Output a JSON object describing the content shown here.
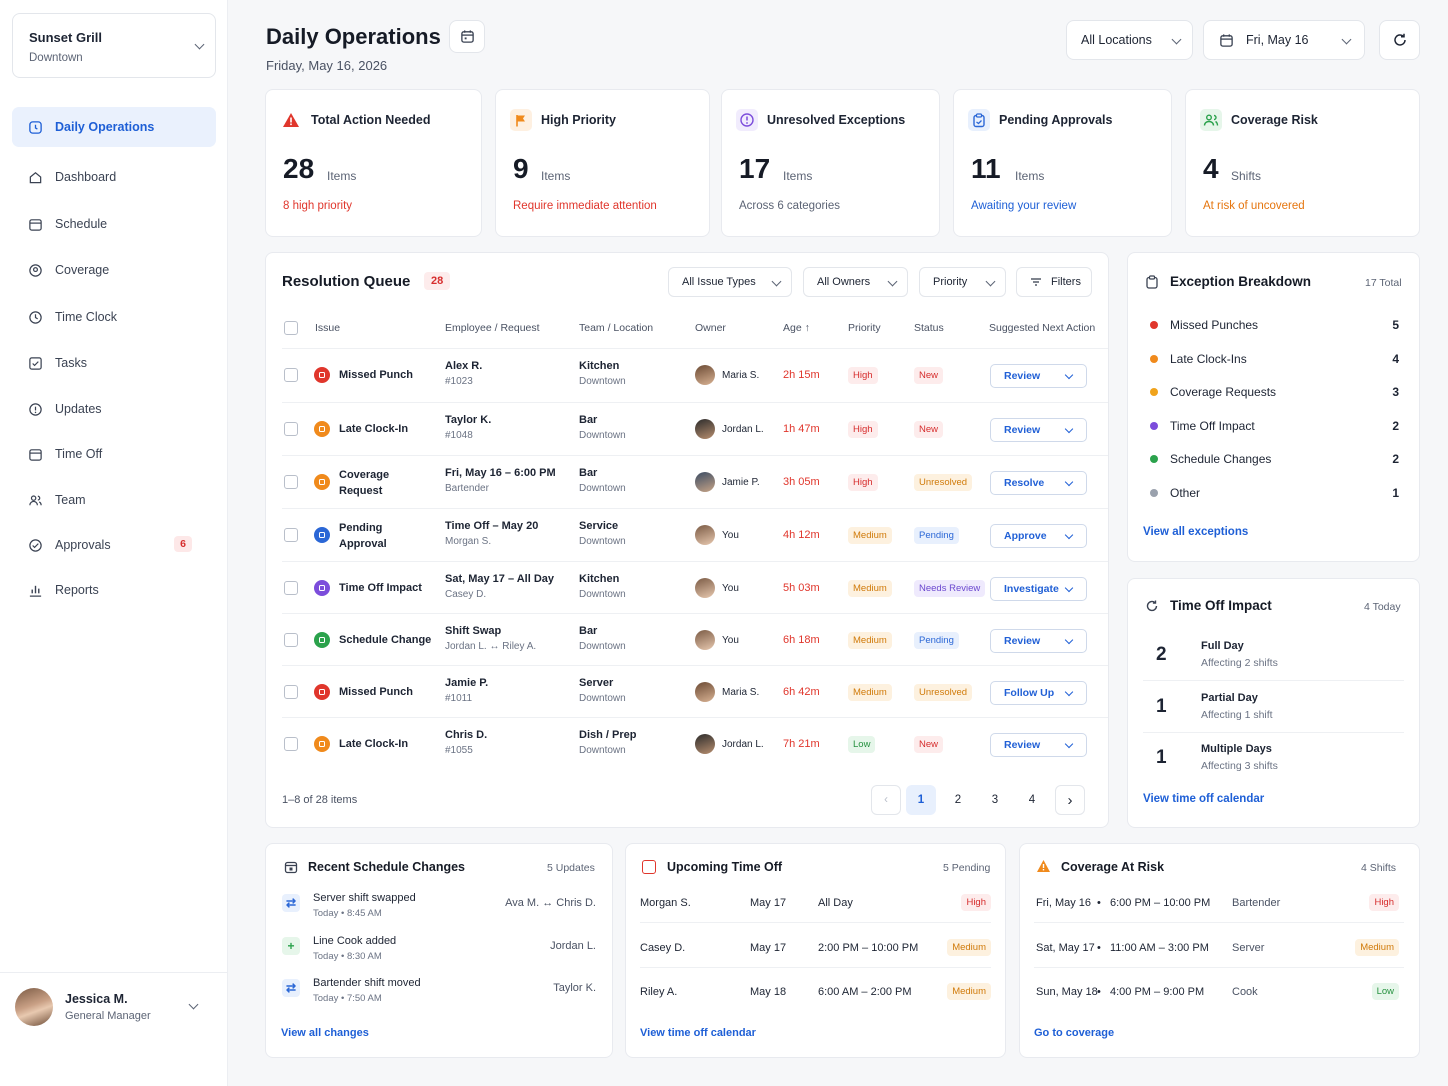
{
  "location": {
    "name": "Sunset Grill",
    "sub": "Downtown"
  },
  "nav": [
    {
      "label": "Daily Operations",
      "icon": "daily-ops-icon"
    },
    {
      "label": "Dashboard",
      "icon": "home-icon"
    },
    {
      "label": "Schedule",
      "icon": "calendar-icon"
    },
    {
      "label": "Coverage",
      "icon": "coverage-icon"
    },
    {
      "label": "Time Clock",
      "icon": "clock-icon"
    },
    {
      "label": "Tasks",
      "icon": "checkbox-icon"
    },
    {
      "label": "Updates",
      "icon": "info-icon"
    },
    {
      "label": "Time Off",
      "icon": "calendar-icon"
    },
    {
      "label": "Team",
      "icon": "team-icon"
    },
    {
      "label": "Approvals",
      "icon": "approvals-icon",
      "badge": "6"
    },
    {
      "label": "Reports",
      "icon": "chart-icon"
    }
  ],
  "user": {
    "name": "Jessica M.",
    "role": "General Manager"
  },
  "header": {
    "title": "Daily Operations",
    "date": "Friday, May 16, 2026",
    "location_filter": "All Locations",
    "date_filter": "Fri, May 16"
  },
  "stats": [
    {
      "label": "Total Action Needed",
      "value": "28",
      "unit": "Items",
      "sub": "8 high priority",
      "color": "#e0362c"
    },
    {
      "label": "High Priority",
      "value": "9",
      "unit": "Items",
      "sub": "Require immediate attention",
      "color": "#e0362c"
    },
    {
      "label": "Unresolved Exceptions",
      "value": "17",
      "unit": "Items",
      "sub": "Across 6 categories",
      "color": "#5c6475"
    },
    {
      "label": "Pending Approvals",
      "value": "11",
      "unit": "Items",
      "sub": "Awaiting your review",
      "color": "#1e5fd6"
    },
    {
      "label": "Coverage Risk",
      "value": "4",
      "unit": "Shifts",
      "sub": "At risk of uncovered",
      "color": "#e5750e"
    }
  ],
  "queue": {
    "title": "Resolution Queue",
    "count": "28",
    "filters": [
      "All Issue Types",
      "All Owners",
      "Priority",
      "Filters"
    ],
    "columns": [
      "Issue",
      "Employee / Request",
      "Team / Location",
      "Owner",
      "Age",
      "Priority",
      "Status",
      "Suggested Next Action"
    ],
    "rows": [
      {
        "issue": "Missed Punch",
        "issue_color": "#e0362c",
        "emp": "Alex R.",
        "emp_sub": "#1023",
        "team": "Kitchen",
        "loc": "Downtown",
        "owner": "Maria S.",
        "age": "2h 15m",
        "priority": "High",
        "status": "New",
        "action": "Review"
      },
      {
        "issue": "Late Clock-In",
        "issue_color": "#f08a1c",
        "emp": "Taylor K.",
        "emp_sub": "#1048",
        "team": "Bar",
        "loc": "Downtown",
        "owner": "Jordan L.",
        "age": "1h 47m",
        "priority": "High",
        "status": "New",
        "action": "Review"
      },
      {
        "issue": "Coverage Request",
        "issue_color": "#f08a1c",
        "emp": "Fri, May 16 – 6:00 PM",
        "emp_sub": "Bartender",
        "team": "Bar",
        "loc": "Downtown",
        "owner": "Jamie P.",
        "age": "3h 05m",
        "priority": "High",
        "status": "Unresolved",
        "action": "Resolve"
      },
      {
        "issue": "Pending Approval",
        "issue_color": "#2b67d6",
        "emp": "Time Off – May 20",
        "emp_sub": "Morgan S.",
        "team": "Service",
        "loc": "Downtown",
        "owner": "You",
        "age": "4h 12m",
        "priority": "Medium",
        "status": "Pending",
        "action": "Approve"
      },
      {
        "issue": "Time Off Impact",
        "issue_color": "#7c4ddb",
        "emp": "Sat, May 17 – All Day",
        "emp_sub": "Casey D.",
        "team": "Kitchen",
        "loc": "Downtown",
        "owner": "You",
        "age": "5h 03m",
        "priority": "Medium",
        "status": "Needs Review",
        "action": "Investigate"
      },
      {
        "issue": "Schedule Change",
        "issue_color": "#2ba24c",
        "emp": "Shift Swap",
        "emp_sub": "Jordan L. ↔ Riley A.",
        "team": "Bar",
        "loc": "Downtown",
        "owner": "You",
        "age": "6h 18m",
        "priority": "Medium",
        "status": "Pending",
        "action": "Review"
      },
      {
        "issue": "Missed Punch",
        "issue_color": "#e0362c",
        "emp": "Jamie P.",
        "emp_sub": "#1011",
        "team": "Server",
        "loc": "Downtown",
        "owner": "Maria S.",
        "age": "6h 42m",
        "priority": "Medium",
        "status": "Unresolved",
        "action": "Follow Up"
      },
      {
        "issue": "Late Clock-In",
        "issue_color": "#f08a1c",
        "emp": "Chris D.",
        "emp_sub": "#1055",
        "team": "Dish / Prep",
        "loc": "Downtown",
        "owner": "Jordan L.",
        "age": "7h 21m",
        "priority": "Low",
        "status": "New",
        "action": "Review"
      }
    ],
    "range": "1–8 of 28 items",
    "pages": [
      "1",
      "2",
      "3",
      "4"
    ]
  },
  "breakdown": {
    "title": "Exception Breakdown",
    "total": "17 Total",
    "items": [
      {
        "label": "Missed Punches",
        "value": "5",
        "color": "#e0362c"
      },
      {
        "label": "Late Clock-Ins",
        "value": "4",
        "color": "#f08a1c"
      },
      {
        "label": "Coverage Requests",
        "value": "3",
        "color": "#f0a31c"
      },
      {
        "label": "Time Off Impact",
        "value": "2",
        "color": "#7c4ddb"
      },
      {
        "label": "Schedule Changes",
        "value": "2",
        "color": "#2ba24c"
      },
      {
        "label": "Other",
        "value": "1",
        "color": "#9aa1ad"
      }
    ],
    "link": "View all exceptions"
  },
  "timeoff_impact": {
    "title": "Time Off Impact",
    "meta": "4 Today",
    "items": [
      {
        "n": "2",
        "title": "Full Day",
        "sub": "Affecting 2 shifts"
      },
      {
        "n": "1",
        "title": "Partial Day",
        "sub": "Affecting 1 shift"
      },
      {
        "n": "1",
        "title": "Multiple Days",
        "sub": "Affecting 3 shifts"
      }
    ],
    "link": "View time off calendar"
  },
  "recent_changes": {
    "title": "Recent Schedule Changes",
    "meta": "5 Updates",
    "items": [
      {
        "title": "Server shift swapped",
        "time": "Today • 8:45 AM",
        "who": "Ava M. ↔ Chris D.",
        "icon": "swap-icon"
      },
      {
        "title": "Line Cook added",
        "time": "Today • 8:30 AM",
        "who": "Jordan L.",
        "icon": "plus-icon"
      },
      {
        "title": "Bartender shift moved",
        "time": "Today • 7:50 AM",
        "who": "Taylor K.",
        "icon": "swap-icon"
      }
    ],
    "link": "View all changes"
  },
  "upcoming": {
    "title": "Upcoming Time Off",
    "meta": "5 Pending",
    "items": [
      {
        "name": "Morgan S.",
        "date": "May 17",
        "time": "All Day",
        "priority": "High"
      },
      {
        "name": "Casey D.",
        "date": "May 17",
        "time": "2:00 PM – 10:00 PM",
        "priority": "Medium"
      },
      {
        "name": "Riley A.",
        "date": "May 18",
        "time": "6:00 AM – 2:00 PM",
        "priority": "Medium"
      }
    ],
    "link": "View time off calendar"
  },
  "coverage": {
    "title": "Coverage At Risk",
    "meta": "4 Shifts",
    "items": [
      {
        "date": "Fri, May 16",
        "time": "6:00 PM – 10:00 PM",
        "role": "Bartender",
        "priority": "High"
      },
      {
        "date": "Sat, May 17",
        "time": "11:00 AM – 3:00 PM",
        "role": "Server",
        "priority": "Medium"
      },
      {
        "date": "Sun, May 18",
        "time": "4:00 PM – 9:00 PM",
        "role": "Cook",
        "priority": "Low"
      }
    ],
    "link": "Go to coverage"
  },
  "colors": {
    "accent": "#1e5fd6",
    "danger": "#e0362c",
    "warning": "#e5750e",
    "success": "#2ba24c"
  }
}
